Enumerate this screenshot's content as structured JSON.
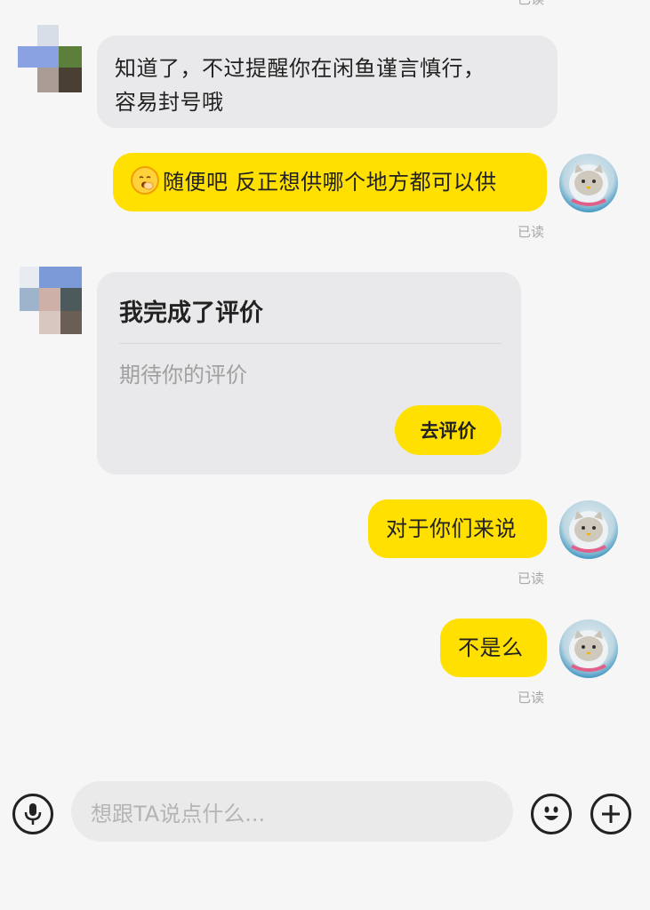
{
  "messages": [
    {
      "side": "in",
      "text_line1": "知道了，不过提醒你在闲鱼谨言慎行，",
      "text_line2": "容易封号哦"
    },
    {
      "side": "out",
      "text": "随便吧 反正想供哪个地方都可以供",
      "emoji": "yawning-face-icon",
      "status": "已读"
    },
    {
      "side": "in",
      "type": "card",
      "title": "我完成了评价",
      "subtitle": "期待你的评价",
      "button": "去评价"
    },
    {
      "side": "out",
      "text": "对于你们来说",
      "status": "已读"
    },
    {
      "side": "out",
      "text": "不是么",
      "status": "已读"
    }
  ],
  "top_partial_status": "已读",
  "composer": {
    "placeholder": "想跟TA说点什么..."
  },
  "colors": {
    "outgoing_bubble": "#ffe000",
    "incoming_bubble": "#e9e9eb",
    "background": "#f6f6f6"
  }
}
